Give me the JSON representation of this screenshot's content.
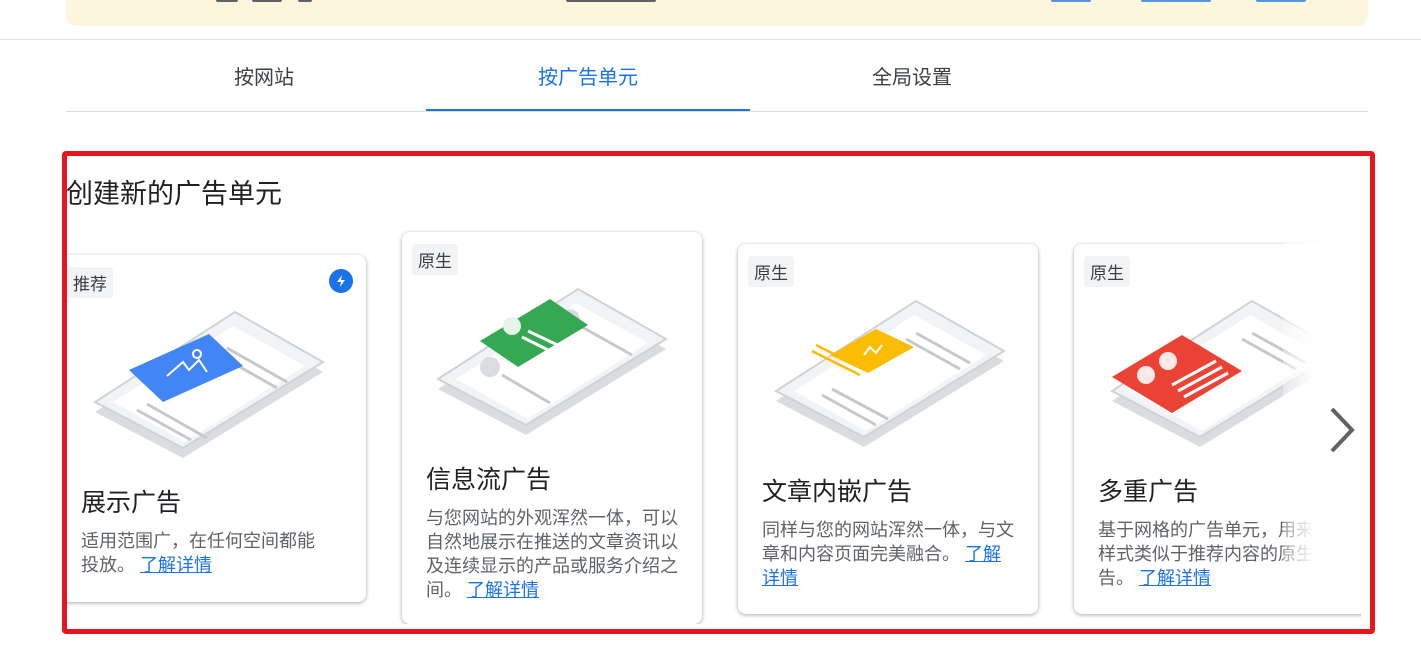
{
  "tabs": [
    {
      "label": "按网站",
      "active": false
    },
    {
      "label": "按广告单元",
      "active": true
    },
    {
      "label": "全局设置",
      "active": false
    }
  ],
  "section": {
    "title": "创建新的广告单元"
  },
  "cards": [
    {
      "tag": "推荐",
      "title": "展示广告",
      "description": "适用范围广，在任何空间都能投放。",
      "link": "了解详情",
      "illustration_color": "#4285f4",
      "icon": "bolt-icon"
    },
    {
      "tag": "原生",
      "title": "信息流广告",
      "description": "与您网站的外观浑然一体，可以自然地展示在推送的文章资讯以及连续显示的产品或服务介绍之间。",
      "link": "了解详情",
      "illustration_color": "#34a853"
    },
    {
      "tag": "原生",
      "title": "文章内嵌广告",
      "description": "同样与您的网站浑然一体，与文章和内容页面完美融合。",
      "link": "了解详情",
      "illustration_color": "#fbbc04"
    },
    {
      "tag": "原生",
      "title": "多重广告",
      "description": "基于网格的广告单元，用来展示样式类似于推荐内容的原生广告。",
      "link": "了解详情",
      "illustration_color": "#ea4335",
      "icon": "bolt-icon"
    }
  ],
  "carousel": {
    "next_icon": "chevron-right-icon"
  },
  "colors": {
    "accent": "#1a73e8",
    "highlight_frame": "#e8151e"
  }
}
